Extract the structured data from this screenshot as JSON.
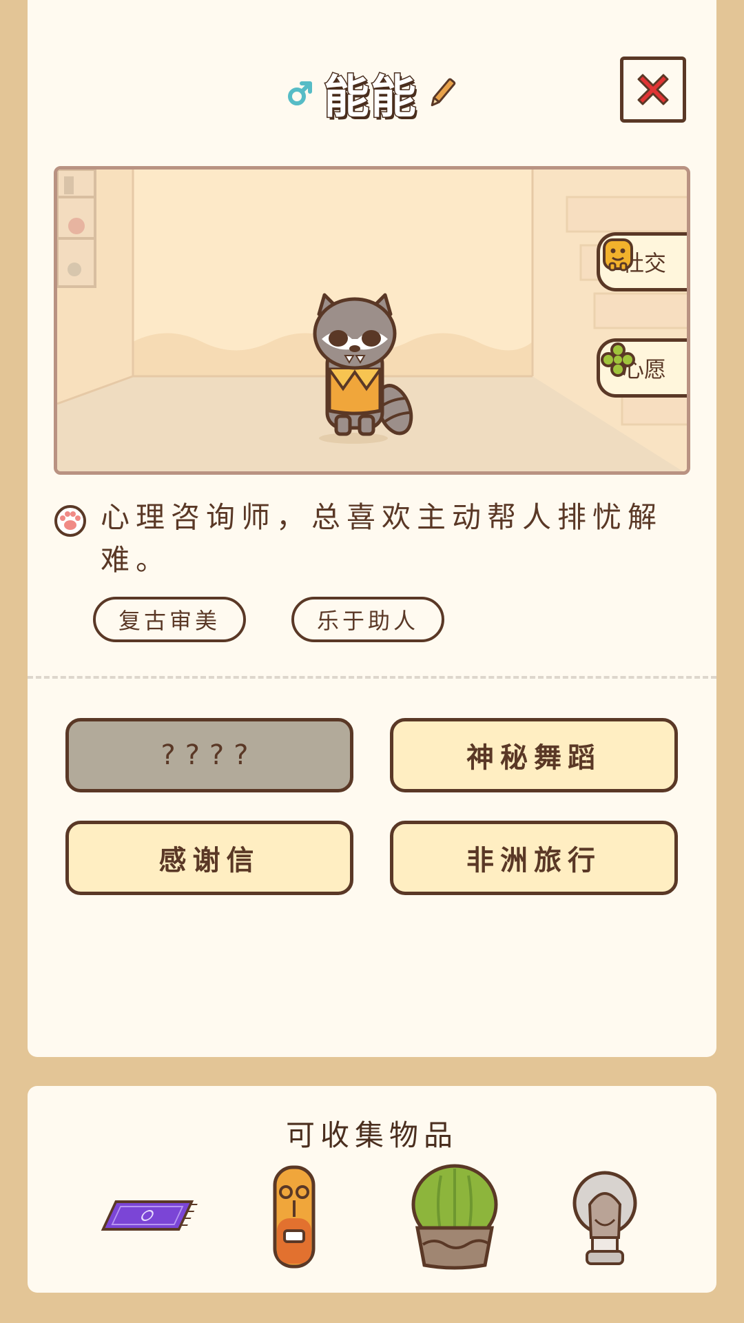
{
  "character": {
    "name": "能能",
    "gender_icon": "male-symbol-icon",
    "description": "心理咨询师，总喜欢主动帮人排忧解难。",
    "tags": [
      "复古审美",
      "乐于助人"
    ]
  },
  "scene_buttons": {
    "social_label": "社交",
    "wish_label": "心愿"
  },
  "skills": [
    "????",
    "神秘舞蹈",
    "感谢信",
    "非洲旅行"
  ],
  "collectibles": {
    "title": "可收集物品",
    "items": [
      "purple-rug-icon",
      "tiki-totem-icon",
      "cactus-pot-icon",
      "bust-lamp-icon"
    ]
  },
  "colors": {
    "background": "#e3c596",
    "card": "#fffaf0",
    "outline": "#5a3826",
    "button_fill": "#ffeec2",
    "locked_fill": "#b2aa9a",
    "gender_blue": "#56bcc6",
    "close_red": "#e03434"
  }
}
